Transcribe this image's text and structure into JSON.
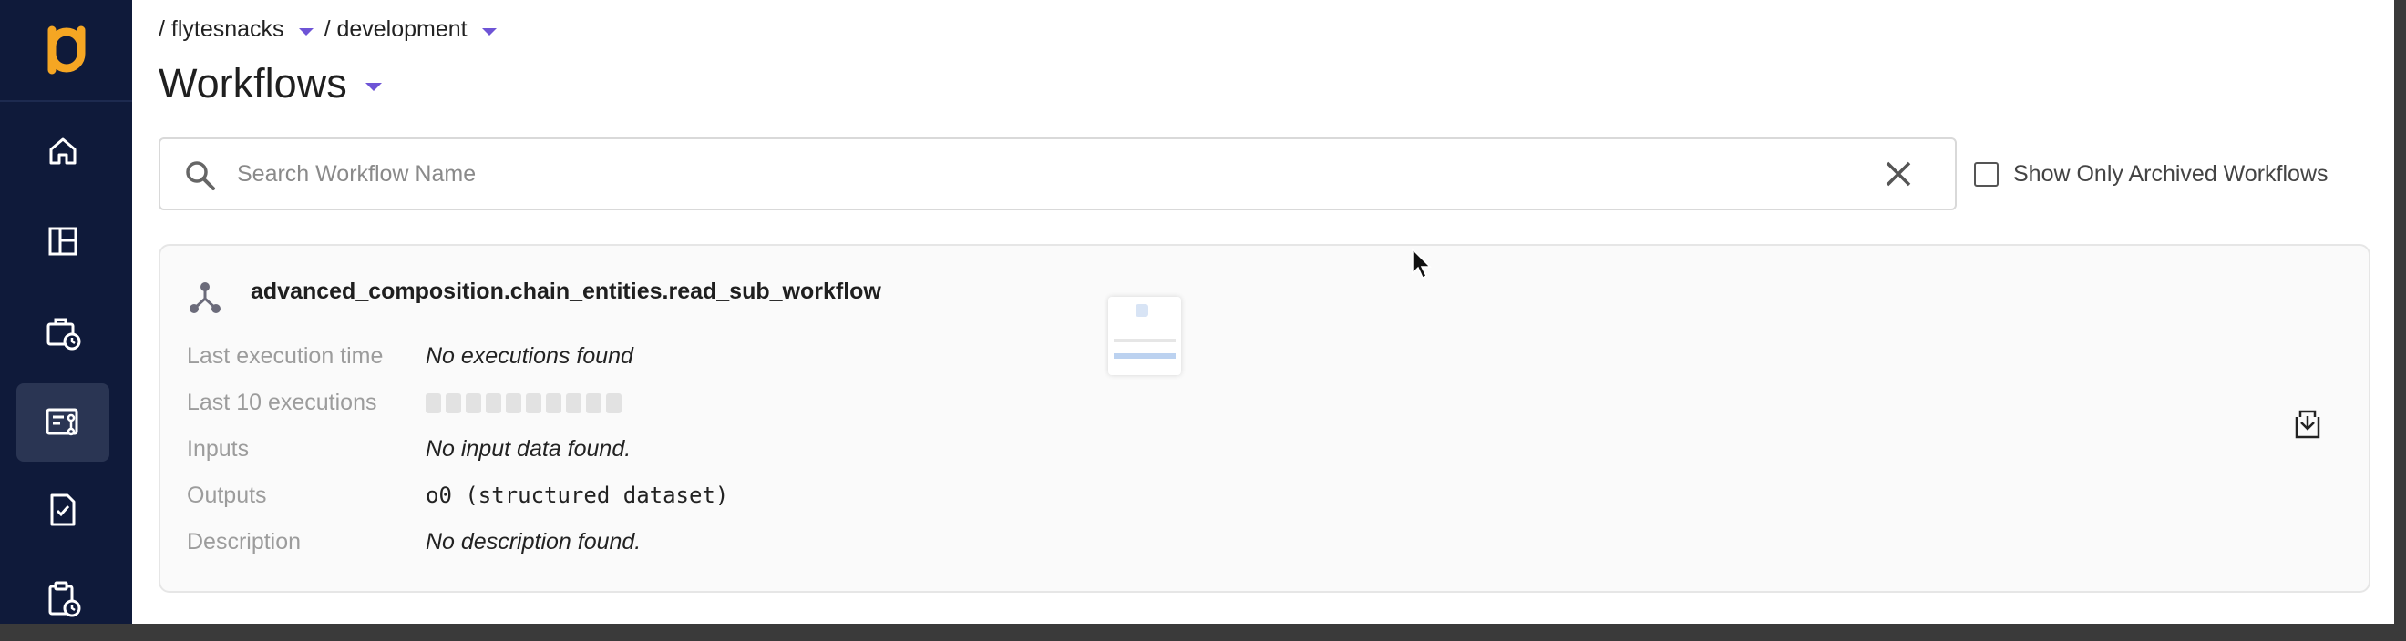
{
  "breadcrumb": {
    "project": "/ flytesnacks",
    "domain": "/ development"
  },
  "page": {
    "title": "Workflows"
  },
  "search": {
    "placeholder": "Search Workflow Name"
  },
  "filters": {
    "archived_label": "Show Only Archived Workflows",
    "archived_checked": false
  },
  "sidebar": {
    "items": [
      {
        "icon": "home-icon",
        "active": false
      },
      {
        "icon": "dashboard-icon",
        "active": false
      },
      {
        "icon": "tasks-icon",
        "active": false
      },
      {
        "icon": "workflows-icon",
        "active": true
      },
      {
        "icon": "launch-plans-icon",
        "active": false
      },
      {
        "icon": "executions-icon",
        "active": false
      }
    ]
  },
  "workflow": {
    "name": "advanced_composition.chain_entities.read_sub_workflow",
    "last_execution_label": "Last execution time",
    "last_execution_value": "No executions found",
    "last_10_label": "Last 10 executions",
    "last_10_count": 10,
    "inputs_label": "Inputs",
    "inputs_value": "No input data found.",
    "outputs_label": "Outputs",
    "outputs_value": "o0 (structured dataset)",
    "description_label": "Description",
    "description_value": "No description found."
  },
  "colors": {
    "sidebar_bg": "#0f1a3a",
    "accent": "#6e54d6",
    "logo": "#f5a623"
  }
}
